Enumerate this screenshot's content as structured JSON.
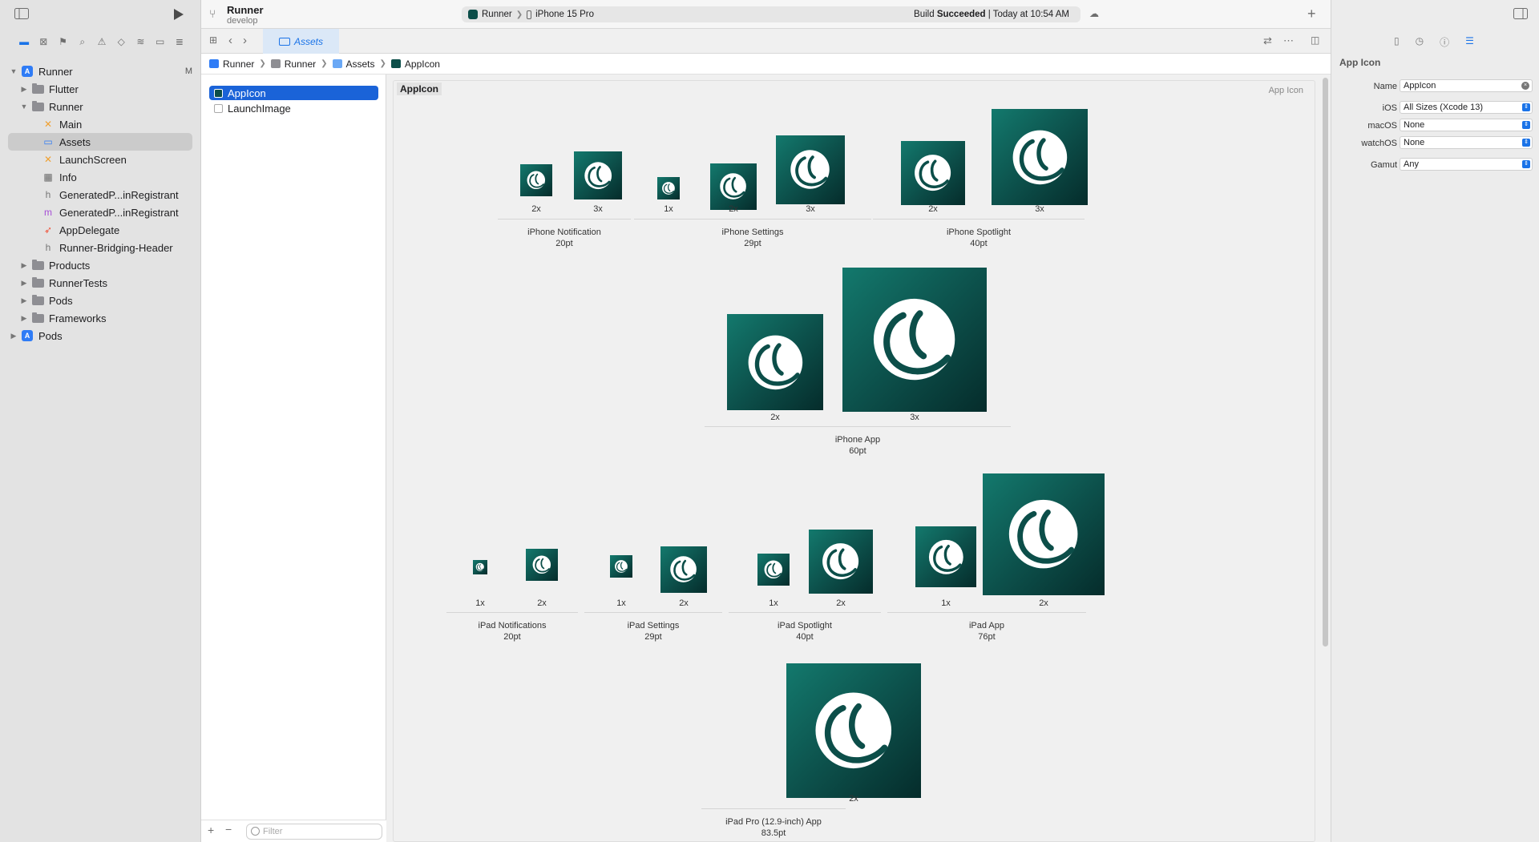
{
  "navigator": {
    "tabs": [
      "folder-icon",
      "source-control-icon",
      "bookmark-icon",
      "find-icon",
      "issue-icon",
      "test-icon",
      "debug-icon",
      "breakpoint-icon",
      "report-icon"
    ],
    "items": [
      {
        "label": "Runner",
        "indent": 0,
        "type": "project",
        "disclosure": "open",
        "badge": "M"
      },
      {
        "label": "Flutter",
        "indent": 1,
        "type": "folder",
        "disclosure": "closed"
      },
      {
        "label": "Runner",
        "indent": 1,
        "type": "folder",
        "disclosure": "open"
      },
      {
        "label": "Main",
        "indent": 2,
        "type": "storyboard"
      },
      {
        "label": "Assets",
        "indent": 2,
        "type": "assets",
        "selected": true
      },
      {
        "label": "LaunchScreen",
        "indent": 2,
        "type": "storyboard"
      },
      {
        "label": "Info",
        "indent": 2,
        "type": "plist"
      },
      {
        "label": "GeneratedP...inRegistrant",
        "indent": 2,
        "type": "header"
      },
      {
        "label": "GeneratedP...inRegistrant",
        "indent": 2,
        "type": "objc"
      },
      {
        "label": "AppDelegate",
        "indent": 2,
        "type": "swift"
      },
      {
        "label": "Runner-Bridging-Header",
        "indent": 2,
        "type": "header"
      },
      {
        "label": "Products",
        "indent": 1,
        "type": "folder",
        "disclosure": "closed"
      },
      {
        "label": "RunnerTests",
        "indent": 1,
        "type": "folder",
        "disclosure": "closed"
      },
      {
        "label": "Pods",
        "indent": 1,
        "type": "folder",
        "disclosure": "closed"
      },
      {
        "label": "Frameworks",
        "indent": 1,
        "type": "folder",
        "disclosure": "closed"
      },
      {
        "label": "Pods",
        "indent": 0,
        "type": "project",
        "disclosure": "closed"
      }
    ]
  },
  "toolbar": {
    "scheme_title": "Runner",
    "branch": "develop",
    "activity_scheme": "Runner",
    "activity_device": "iPhone 15 Pro",
    "build_label": "Build ",
    "build_status": "Succeeded",
    "build_time": " | Today at 10:54 AM"
  },
  "tabs": {
    "active": "Assets"
  },
  "breadcrumbs": [
    "Runner",
    "Runner",
    "Assets",
    "AppIcon"
  ],
  "asset_list": {
    "items": [
      {
        "label": "AppIcon",
        "selected": true
      },
      {
        "label": "LaunchImage",
        "selected": false
      }
    ],
    "filter_placeholder": "Filter"
  },
  "canvas": {
    "set_title": "AppIcon",
    "set_kind": "App Icon",
    "groups": [
      {
        "name": "iPhone Notification",
        "size": "20pt",
        "slots": [
          "2x",
          "3x"
        ]
      },
      {
        "name": "iPhone Settings",
        "size": "29pt",
        "slots": [
          "1x",
          "2x",
          "3x"
        ]
      },
      {
        "name": "iPhone Spotlight",
        "size": "40pt",
        "slots": [
          "2x",
          "3x"
        ]
      },
      {
        "name": "iPhone App",
        "size": "60pt",
        "slots": [
          "2x",
          "3x"
        ]
      },
      {
        "name": "iPad Notifications",
        "size": "20pt",
        "slots": [
          "1x",
          "2x"
        ]
      },
      {
        "name": "iPad Settings",
        "size": "29pt",
        "slots": [
          "1x",
          "2x"
        ]
      },
      {
        "name": "iPad Spotlight",
        "size": "40pt",
        "slots": [
          "1x",
          "2x"
        ]
      },
      {
        "name": "iPad App",
        "size": "76pt",
        "slots": [
          "1x",
          "2x"
        ]
      },
      {
        "name": "iPad Pro (12.9-inch) App",
        "size": "83.5pt",
        "slots": [
          "2x"
        ]
      }
    ]
  },
  "inspector": {
    "title": "App Icon",
    "fields": [
      {
        "label": "Name",
        "value": "AppIcon",
        "kind": "text"
      },
      {
        "label": "iOS",
        "value": "All Sizes (Xcode 13)",
        "kind": "popup"
      },
      {
        "label": "macOS",
        "value": "None",
        "kind": "popup"
      },
      {
        "label": "watchOS",
        "value": "None",
        "kind": "popup"
      },
      {
        "label": "Gamut",
        "value": "Any",
        "kind": "popup"
      }
    ]
  },
  "colors": {
    "accent": "#1a73e8",
    "icon_teal": "#0c4e49"
  }
}
